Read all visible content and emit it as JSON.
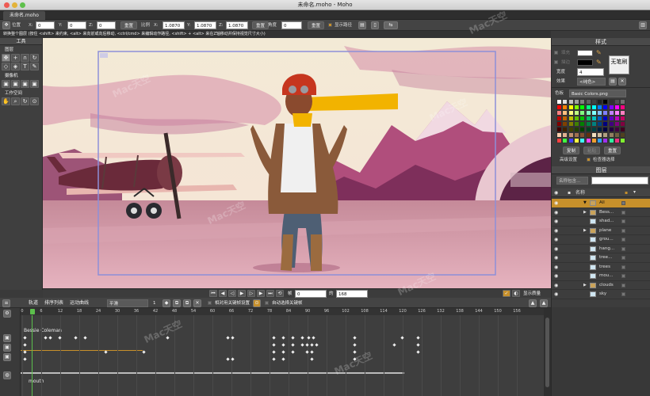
{
  "window": {
    "title": "未命名.moho - Moho",
    "doc_tab": "未命名.moho"
  },
  "tool_options": {
    "position_label": "位置",
    "x_label": "X:",
    "x_value": "0",
    "y_label": "Y:",
    "y_value": "0",
    "z_label": "Z:",
    "z_value": "0",
    "reset1": "重置",
    "scale_label": "比例",
    "sx_label": "X:",
    "sx_value": "1.0870",
    "sy_label": "Y:",
    "sy_value": "1.0870",
    "sz_label": "Z:",
    "sz_value": "1.0870",
    "angle_label": "角度",
    "angle_value": "0",
    "reset2": "重置",
    "show_path": "显示路径"
  },
  "status_text": "转换整个图层 (按住 <shift> 来约束, <alt> 来向前或向后移动, <ctrl/cmd> 来编辑动作路径, <shift> + <alt> 来在Z轴移动并保持视觉尺寸大小)",
  "tools": {
    "title": "工具",
    "layer_section": "图层",
    "camera_section": "摄像机",
    "workspace_section": "工作空间"
  },
  "playback": {
    "frame_label": "帧",
    "frame_value": "0",
    "of_label": "的",
    "end_value": "168",
    "quality_label": "显示质量"
  },
  "timeline": {
    "tabs": [
      "轨道",
      "排序列表",
      "运动曲线"
    ],
    "interp": "平滑",
    "relative_label": "相对用关键帧设置",
    "auto_label": "自动选择关键帧",
    "ticks": [
      "0",
      "6",
      "12",
      "18",
      "24",
      "30",
      "36",
      "42",
      "48",
      "54",
      "60",
      "66",
      "72",
      "78",
      "84",
      "90",
      "96",
      "102",
      "108",
      "114",
      "120",
      "126",
      "132",
      "138",
      "144",
      "150",
      "156"
    ],
    "track1_name": "Bessie Coleman",
    "track2_name": "mouth"
  },
  "style_panel": {
    "title": "样式",
    "fill_label": "填充",
    "stroke_label": "描边",
    "width_label": "宽度",
    "width_value": "4",
    "effect_label": "效果",
    "effect_value": "<纯色>",
    "no_brush": "无笔刷",
    "palette_label": "色板",
    "palette_value": "Basic Colors.png",
    "copy_btn": "复制",
    "paste_btn": "粘贴",
    "reset_btn": "重置",
    "advanced": "高级设置",
    "check": "检查器选择"
  },
  "layers_panel": {
    "title": "图层",
    "search_placeholder": "名称包含...",
    "name_header": "名称",
    "layers": [
      "All",
      "Bess...",
      "shad...",
      "plane",
      "grou...",
      "hang...",
      "tree...",
      "trees",
      "mou...",
      "clouds",
      "sky"
    ]
  },
  "watermark": "Mac天空"
}
